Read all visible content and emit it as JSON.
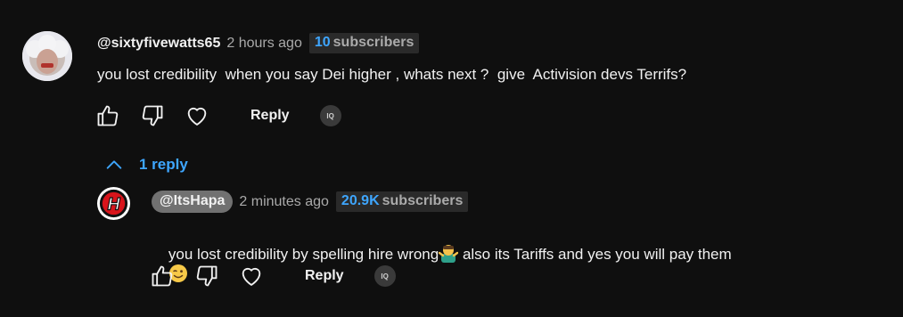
{
  "comment": {
    "handle": "@sixtyfivewatts65",
    "time": "2 hours ago",
    "subs_count": "10",
    "subs_label": "subscribers",
    "text": "you lost credibility  when you say Dei higher , whats next ?  give  Activision devs Terrifs?",
    "reply_label": "Reply",
    "iq_label": "IQ"
  },
  "replies_toggle": {
    "label": "1 reply",
    "icon": "chevron-up-icon"
  },
  "reply": {
    "handle": "@ItsHapa",
    "time": "2 minutes ago",
    "subs_count": "20.9K",
    "subs_label": "subscribers",
    "text_part1": "you lost credibility by spelling hire wrong",
    "text_part2": " also its Tariffs and yes you will pay them",
    "reply_label": "Reply",
    "iq_label": "IQ",
    "avatar_letter": "H"
  },
  "colors": {
    "background": "#0f0f0f",
    "link": "#3ea6ff",
    "muted": "#aaaaaa"
  }
}
